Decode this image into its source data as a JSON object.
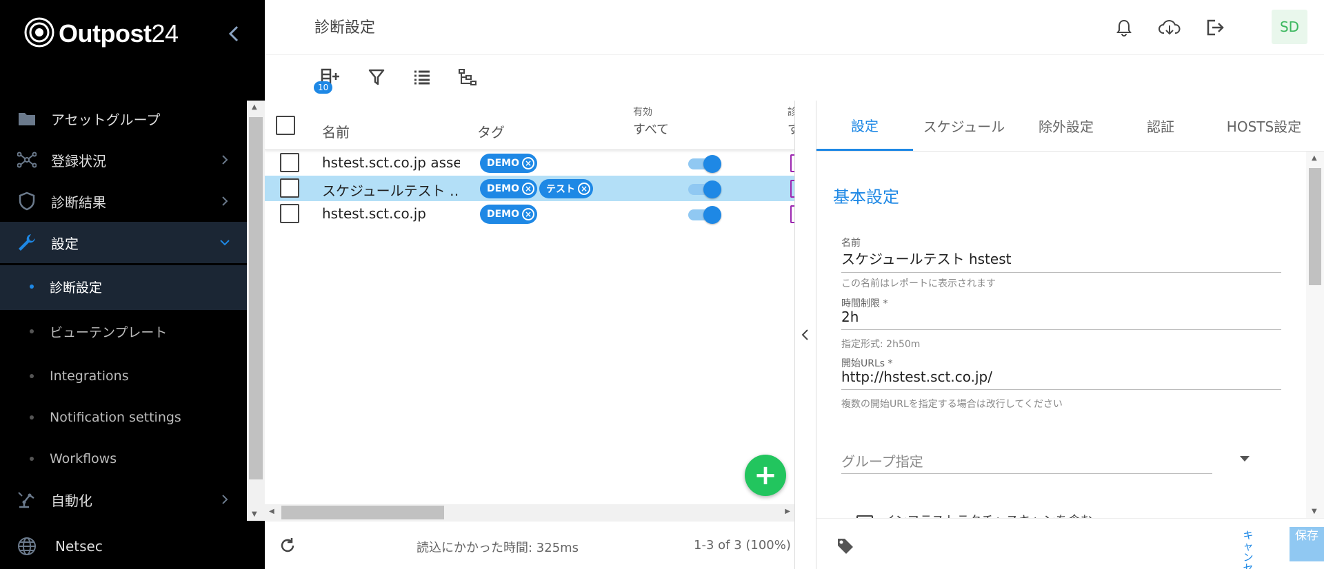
{
  "brand": {
    "name": "Outpost",
    "number": "24"
  },
  "sidebar": {
    "items": [
      {
        "label": "アセットグループ",
        "icon": "folder-icon"
      },
      {
        "label": "登録状況",
        "icon": "network-icon"
      },
      {
        "label": "診断結果",
        "icon": "shield-icon"
      },
      {
        "label": "設定",
        "icon": "wrench-icon"
      },
      {
        "label": "自動化",
        "icon": "robot-arm-icon"
      },
      {
        "label": "Netsec",
        "icon": "globe-icon"
      }
    ],
    "sub_items": [
      {
        "label": "診断設定"
      },
      {
        "label": "ビューテンプレート"
      },
      {
        "label": "Integrations"
      },
      {
        "label": "Notification settings"
      },
      {
        "label": "Workflows"
      }
    ]
  },
  "header": {
    "title": "診断設定",
    "avatar": "SD"
  },
  "toolbar": {
    "badge": "10"
  },
  "table": {
    "col_name": "名前",
    "col_tag": "タグ",
    "col_enabled_label": "有効",
    "col_enabled_filter": "すべて",
    "col_next_label": "診",
    "col_next_filter": "す",
    "rows": [
      {
        "name": "hstest.sct.co.jp asset…",
        "tags": [
          "DEMO"
        ],
        "enabled": true,
        "selected": false
      },
      {
        "name": "スケジュールテスト …",
        "tags": [
          "DEMO",
          "テスト"
        ],
        "enabled": true,
        "selected": true
      },
      {
        "name": "hstest.sct.co.jp",
        "tags": [
          "DEMO"
        ],
        "enabled": true,
        "selected": false
      }
    ]
  },
  "footer": {
    "load_time": "読込にかかった時間: 325ms",
    "count": "1-3 of 3 (100%)"
  },
  "panel": {
    "tabs": [
      "設定",
      "スケジュール",
      "除外設定",
      "認証",
      "HOSTS設定"
    ],
    "section_title": "基本設定",
    "name_label": "名前",
    "name_value": "スケジュールテスト hstest",
    "name_hint": "この名前はレポートに表示されます",
    "time_label": "時間制限 *",
    "time_value": "2h",
    "time_hint": "指定形式: 2h50m",
    "urls_label": "開始URLs *",
    "urls_value": "http://hstest.sct.co.jp/",
    "urls_hint": "複数の開始URLを指定する場合は改行してください",
    "group_placeholder": "グループ指定",
    "cut_text": "インフラストラクチャスキャンを含む",
    "cancel_label": "キャンセル",
    "save_label": "保存"
  },
  "colors": {
    "accent": "#1e88e5",
    "fab": "#22c55e",
    "sidebar_bg": "#000000",
    "active_nav": "#1b2634"
  }
}
